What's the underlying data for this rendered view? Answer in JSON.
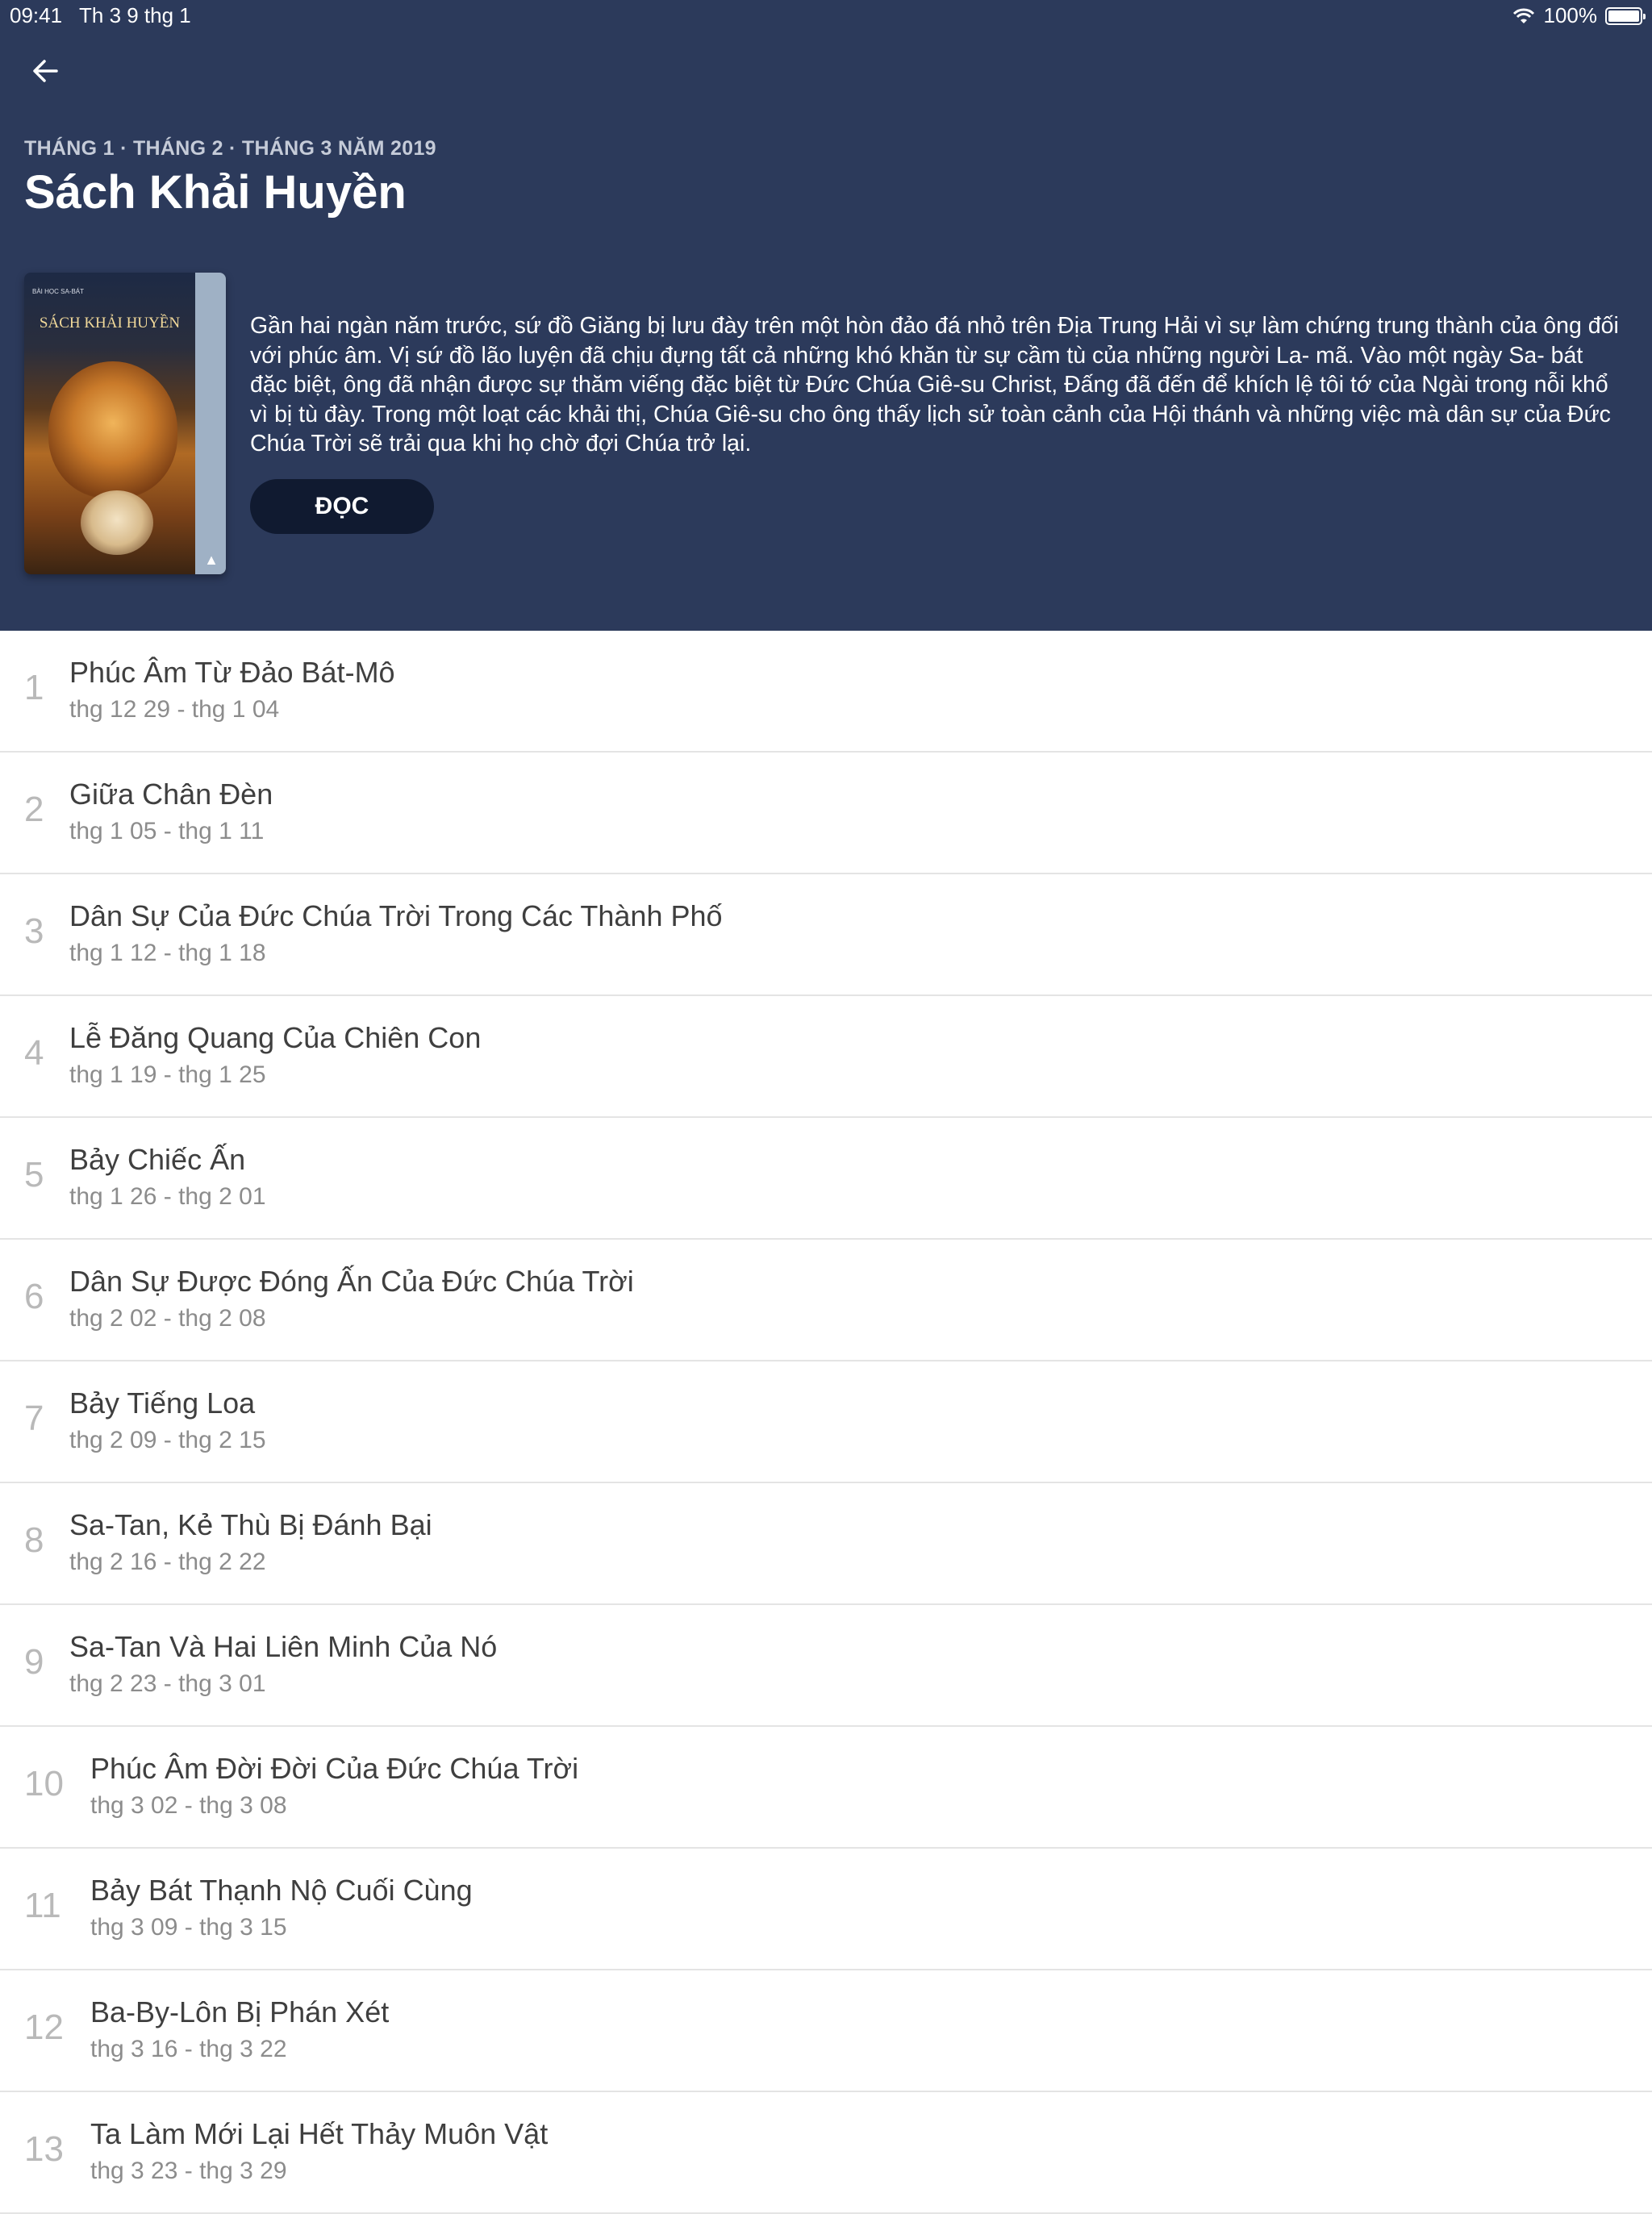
{
  "status_bar": {
    "time": "09:41",
    "date": "Th 3 9 thg 1",
    "battery": "100%",
    "icons": [
      "wifi-icon",
      "battery-icon"
    ]
  },
  "header": {
    "back_icon": "arrow-left-icon",
    "eyebrow": "THÁNG 1 · THÁNG 2 · THÁNG 3 NĂM 2019",
    "title": "Sách Khải Huyền",
    "description": "Gần hai ngàn năm trước, sứ đồ Giăng bị lưu đày trên một hòn đảo đá nhỏ trên Địa Trung Hải vì sự làm chứng trung thành của ông đối với phúc âm. Vị sứ đồ lão luyện đã chịu đựng tất cả những khó khăn từ sự cầm tù của những người La- mã. Vào một ngày Sa- bát đặc biệt, ông đã nhận được sự thăm viếng đặc biệt từ Đức Chúa Giê-su Christ, Đấng đã đến để khích lệ tôi tớ của Ngài trong nỗi khổ vì bị tù đày. Trong một loạt các khải thị, Chúa Giê-su cho ông thấy lịch sử toàn cảnh của Hội thánh và những việc mà dân sự của Đức Chúa Trời sẽ trải qua khi họ chờ đợi Chúa trở lại.",
    "read_button": "ĐỌC",
    "cover": {
      "small_text": "BÀI HỌC SA-BÁT",
      "title": "SÁCH KHẢI HUYỀN"
    },
    "colors": {
      "background": "#2c3a5b",
      "button": "#101a30"
    }
  },
  "lessons": [
    {
      "number": "1",
      "title": "Phúc Âm Từ Đảo Bát-Mô",
      "dates": "thg 12 29 - thg 1 04"
    },
    {
      "number": "2",
      "title": "Giữa Chân Đèn",
      "dates": "thg 1 05 - thg 1 11"
    },
    {
      "number": "3",
      "title": "Dân Sự Của Đức Chúa Trời Trong Các Thành Phố",
      "dates": "thg 1 12 - thg 1 18"
    },
    {
      "number": "4",
      "title": "Lễ Đăng Quang Của Chiên Con",
      "dates": "thg 1 19 - thg 1 25"
    },
    {
      "number": "5",
      "title": "Bảy Chiếc Ấn",
      "dates": "thg 1 26 - thg 2 01"
    },
    {
      "number": "6",
      "title": "Dân Sự Được Đóng Ấn Của Đức Chúa Trời",
      "dates": "thg 2 02 - thg 2 08"
    },
    {
      "number": "7",
      "title": "Bảy Tiếng Loa",
      "dates": "thg 2 09 - thg 2 15"
    },
    {
      "number": "8",
      "title": "Sa-Tan, Kẻ Thù Bị Đánh Bại",
      "dates": "thg 2 16 - thg 2 22"
    },
    {
      "number": "9",
      "title": "Sa-Tan Và Hai Liên Minh Của Nó",
      "dates": "thg 2 23 - thg 3 01"
    },
    {
      "number": "10",
      "title": "Phúc Âm Đời Đời Của Đức Chúa Trời",
      "dates": "thg 3 02 - thg 3 08"
    },
    {
      "number": "11",
      "title": "Bảy Bát Thạnh Nộ Cuối Cùng",
      "dates": "thg 3 09 - thg 3 15"
    },
    {
      "number": "12",
      "title": "Ba-By-Lôn Bị Phán Xét",
      "dates": "thg 3 16 - thg 3 22"
    },
    {
      "number": "13",
      "title": "Ta Làm Mới Lại Hết Thảy Muôn Vật",
      "dates": "thg 3 23 - thg 3 29"
    }
  ]
}
